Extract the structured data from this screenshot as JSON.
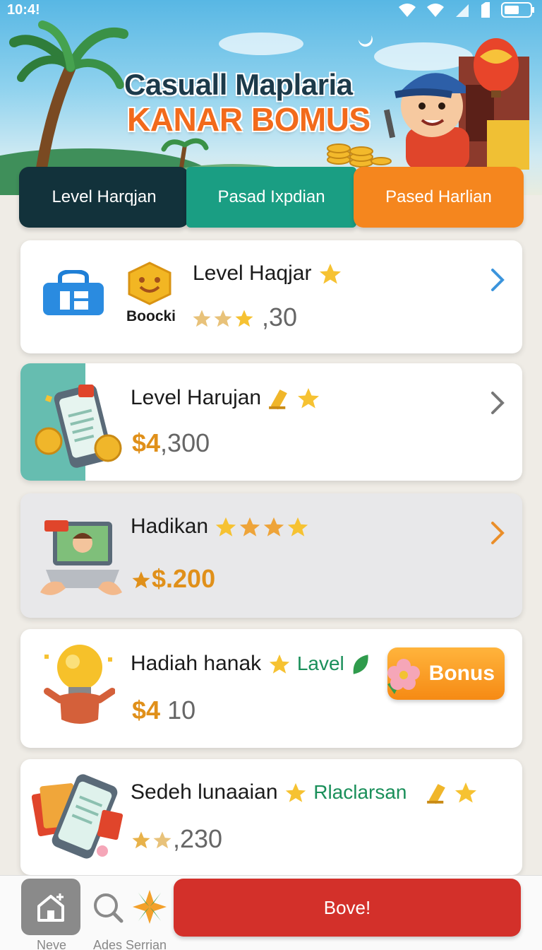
{
  "status_bar": {
    "time": "10:4!"
  },
  "hero": {
    "title": "Casuall Maplaria",
    "subtitle": "KANAR BOMUS"
  },
  "tabs": [
    {
      "label": "Level Harqjan",
      "color": "#12323b"
    },
    {
      "label": "Pasad Ixpdian",
      "color": "#1a9e83"
    },
    {
      "label": "Pased Harlian",
      "color": "#f5861e"
    }
  ],
  "cards": [
    {
      "icon": "store-icon",
      "badge_label": "Boocki",
      "title": "Level Haqjar",
      "amount": ",30"
    },
    {
      "icon": "phone-coins-icon",
      "title": "Level Harujan",
      "amount_accent": "$4",
      "amount_rest": ",300"
    },
    {
      "icon": "laptop-icon",
      "title": "Hadikan",
      "amount": "$.200"
    },
    {
      "icon": "lightbulb-icon",
      "title": "Hadiah hanak",
      "tag": "Lavel",
      "amount_accent": "$4",
      "amount_rest": "10",
      "bonus_label": "Bonus"
    },
    {
      "icon": "phone-cards-icon",
      "title": "Sedeh lunaaian",
      "tag": "Rlaclarsan",
      "amount": ",230"
    }
  ],
  "bottom_nav": {
    "home_label": "Neve",
    "search_label": "Ades Serrian",
    "action_label": "Bove!",
    "action_color": "#d3302a"
  }
}
